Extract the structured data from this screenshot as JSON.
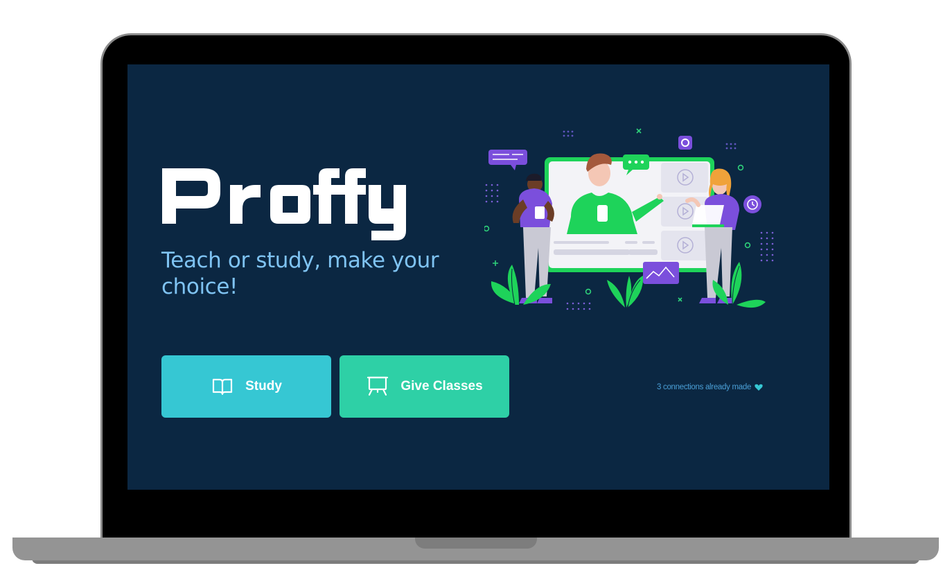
{
  "app": {
    "logo_text": "Proffy",
    "tagline": "Teach or study, make your choice!"
  },
  "actions": {
    "study_label": "Study",
    "give_classes_label": "Give Classes"
  },
  "footer": {
    "connections_text": "3 connections already made"
  },
  "icons": {
    "study": "open-book-icon",
    "give_classes": "presentation-board-icon",
    "connections": "purple-heart-icon"
  },
  "colors": {
    "background": "#0b2742",
    "tagline": "#7fc3f2",
    "study_button": "#36c7d3",
    "give_classes_button": "#2ed0a6",
    "connections_text": "#4a9fd6",
    "accent_green": "#1ed35a",
    "accent_purple": "#6a3fc0"
  }
}
